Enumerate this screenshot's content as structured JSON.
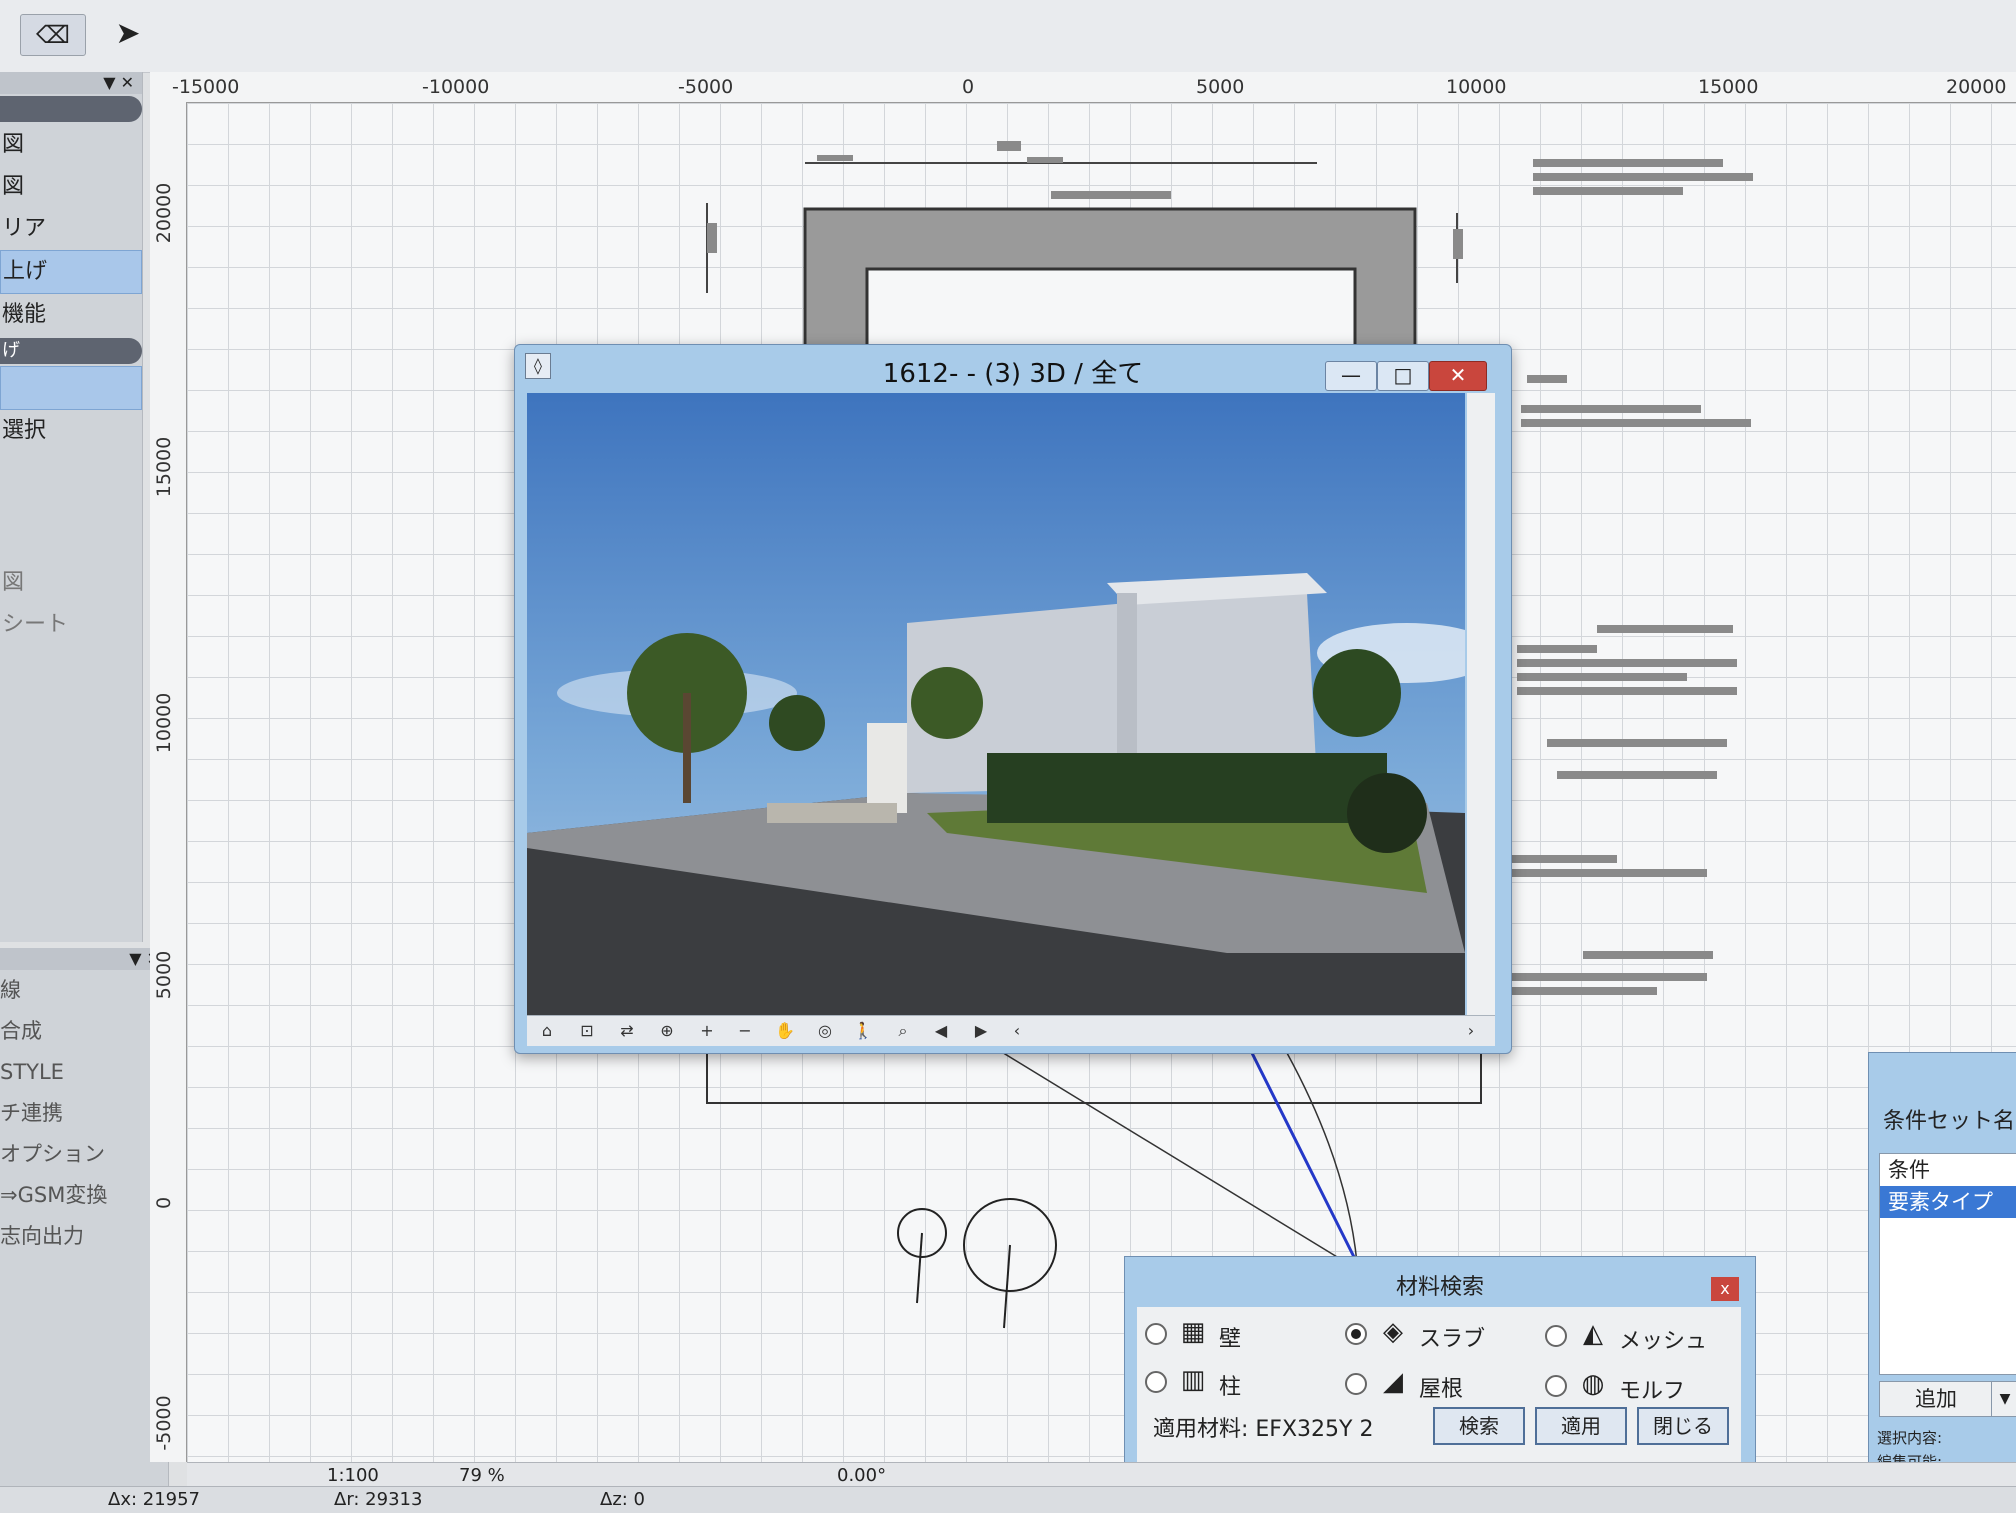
{
  "ruler": {
    "top_ticks": [
      "-15000",
      "-10000",
      "-5000",
      "0",
      "5000",
      "10000",
      "15000",
      "20000"
    ],
    "left_ticks": [
      "20000",
      "15000",
      "10000",
      "5000",
      "0",
      "-5000"
    ]
  },
  "left_panel": {
    "items": [
      "図",
      "図",
      "リア",
      "上げ",
      "機能",
      "げ",
      "",
      "選択",
      "",
      "図",
      "シート"
    ]
  },
  "left_panel2": {
    "items": [
      "線",
      "合成",
      "STYLE",
      "チ連携",
      "オプション",
      "⇒GSM変換",
      "志向出力"
    ]
  },
  "window3d": {
    "title": "1612- - (3) 3D / 全て",
    "min": "—",
    "max": "□",
    "close": "✕"
  },
  "material_dialog": {
    "title": "材料検索",
    "close": "x",
    "types": [
      {
        "label": "壁",
        "icon": "wall-icon",
        "glyph": "▦"
      },
      {
        "label": "スラブ",
        "icon": "slab-icon",
        "glyph": "◈"
      },
      {
        "label": "メッシュ",
        "icon": "mesh-icon",
        "glyph": "◭"
      },
      {
        "label": "柱",
        "icon": "column-icon",
        "glyph": "▥"
      },
      {
        "label": "屋根",
        "icon": "roof-icon",
        "glyph": "◢"
      },
      {
        "label": "モルフ",
        "icon": "morph-icon",
        "glyph": "◍"
      }
    ],
    "selected_type": "スラブ",
    "applied_material": "適用材料: EFX325Y 2",
    "search_button": "検索",
    "apply_button": "適用",
    "close_button": "閉じる"
  },
  "criteria_panel": {
    "label": "条件セット名:",
    "list": [
      "条件",
      "要素タイプ"
    ],
    "selected": "要素タイプ",
    "add_button": "追加",
    "selection_content": "選択内容:",
    "editable": "編集可能:"
  },
  "status": {
    "scale": "1:100",
    "zoom": "79 %",
    "angle": "0.00°",
    "ax": "Δx: 21957",
    "ar": "Δr: 29313",
    "az": "Δz: 0"
  },
  "colors": {
    "window_frame": "#a8cbe9",
    "sky": "#4a83c8",
    "close_red": "#c9463d",
    "selection_blue": "#3a78d4"
  }
}
